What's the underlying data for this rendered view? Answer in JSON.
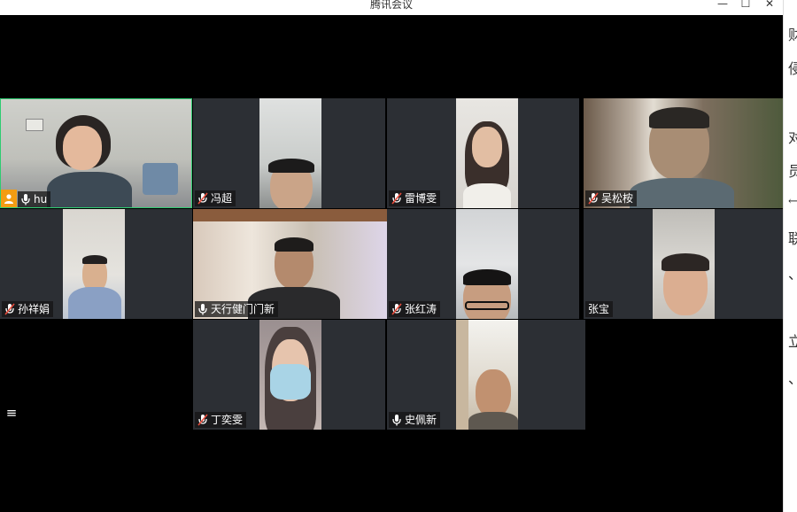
{
  "window": {
    "title": "腾讯会议",
    "minimize_glyph": "—",
    "maximize_glyph": "☐",
    "close_glyph": "✕"
  },
  "participants": [
    {
      "name": "hu",
      "mic": "on",
      "active": true
    },
    {
      "name": "冯超",
      "mic": "muted"
    },
    {
      "name": "雷博雯",
      "mic": "muted"
    },
    {
      "name": "吴松桉",
      "mic": "muted"
    },
    {
      "name": "孙祥娟",
      "mic": "muted"
    },
    {
      "name": "天行健门门新",
      "mic": "on"
    },
    {
      "name": "张红涛",
      "mic": "muted"
    },
    {
      "name": "张宝",
      "mic": "none"
    },
    {
      "name": "丁奕雯",
      "mic": "muted"
    },
    {
      "name": "史佩新",
      "mic": "on"
    }
  ],
  "controls": {
    "menu_icon": "≡"
  },
  "side_doc": {
    "chars": [
      "财",
      "侵",
      "对",
      "员",
      "←",
      "联",
      "、",
      "立",
      "、"
    ]
  },
  "colors": {
    "stage_bg": "#000000",
    "tile_bg": "#2c2f34",
    "active_border": "#2ecc71",
    "host_badge": "#f39c12"
  }
}
